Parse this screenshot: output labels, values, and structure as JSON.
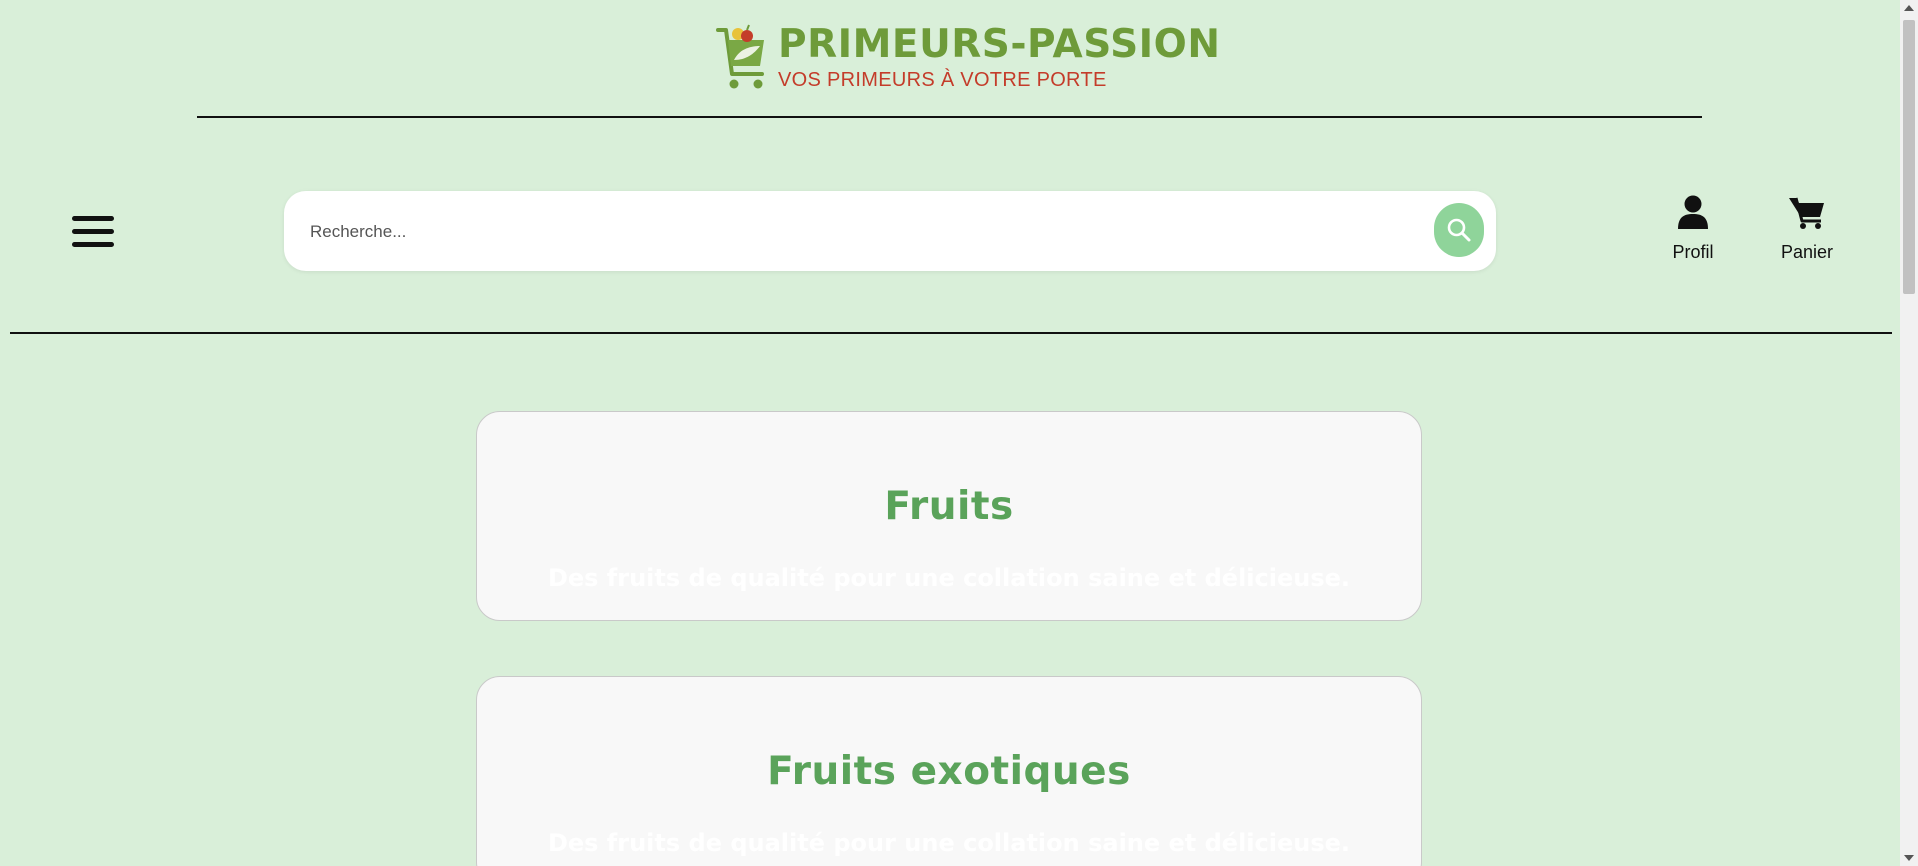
{
  "header": {
    "brand": "PRIMEURS-PASSION",
    "tagline": "VOS PRIMEURS À VOTRE PORTE",
    "logo_icon": "shopping-cart-bag-logo",
    "brand_color": "#6e9b3a",
    "tagline_color": "#c43c2a"
  },
  "nav": {
    "menu_icon": "hamburger-menu-icon",
    "search": {
      "placeholder": "Recherche...",
      "value": "",
      "button_icon": "magnifier-icon",
      "button_color": "#8fd49a"
    },
    "profile_label": "Profil",
    "cart_label": "Panier"
  },
  "categories": [
    {
      "title": "Fruits",
      "description": "Des fruits de qualité pour une collation saine et délicieuse."
    },
    {
      "title": "Fruits exotiques",
      "description": "Des fruits de qualité pour une collation saine et délicieuse."
    }
  ],
  "colors": {
    "background": "#d9efd9",
    "card_title": "#5aa35a",
    "card_bg": "#f8f8f8"
  }
}
